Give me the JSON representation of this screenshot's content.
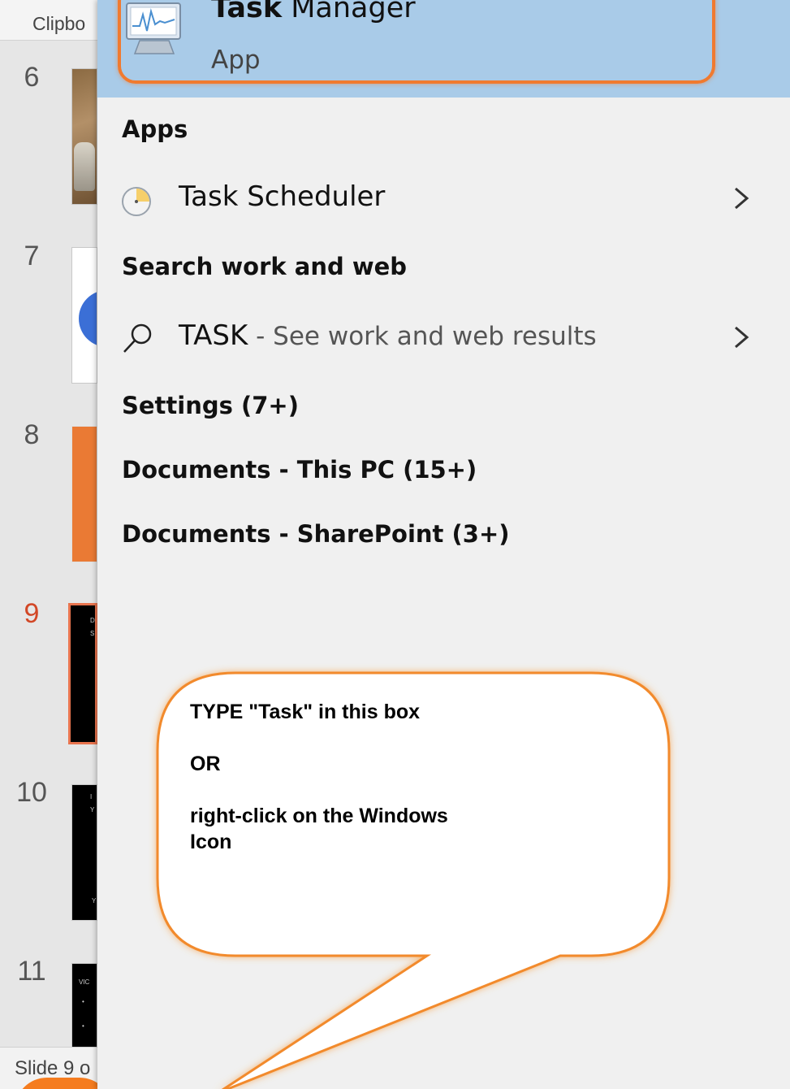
{
  "ribbon": {
    "clipboard_label": "Clipbo"
  },
  "slides": [
    {
      "number": "6"
    },
    {
      "number": "7"
    },
    {
      "number": "8"
    },
    {
      "number": "9",
      "current": true
    },
    {
      "number": "10"
    },
    {
      "number": "11"
    }
  ],
  "status_bar": {
    "text": "Slide 9 o"
  },
  "search": {
    "best_match": {
      "title_bold": "Task",
      "title_rest": " Manager",
      "type": "App"
    },
    "sections": {
      "apps": "Apps",
      "web": "Search work and web",
      "settings": "Settings (7+)",
      "docs_pc": "Documents - This PC (15+)",
      "docs_sp": "Documents - SharePoint (3+)"
    },
    "apps_item": {
      "bold": "Task",
      "rest": " Scheduler"
    },
    "web_item": {
      "query": "TASK",
      "suffix": " - See work and web results"
    }
  },
  "callout": {
    "line1": "TYPE \"Task\" in this box",
    "line2": "OR",
    "line3": "right-click on the Windows Icon"
  },
  "colors": {
    "highlight": "#a9cbe8",
    "accent_orange": "#f07a2f",
    "current_slide": "#d24726"
  },
  "icons": {
    "best_match": "task-manager-icon",
    "apps_item": "task-scheduler-icon",
    "web_item": "search-icon",
    "chevron": "chevron-right-icon"
  }
}
